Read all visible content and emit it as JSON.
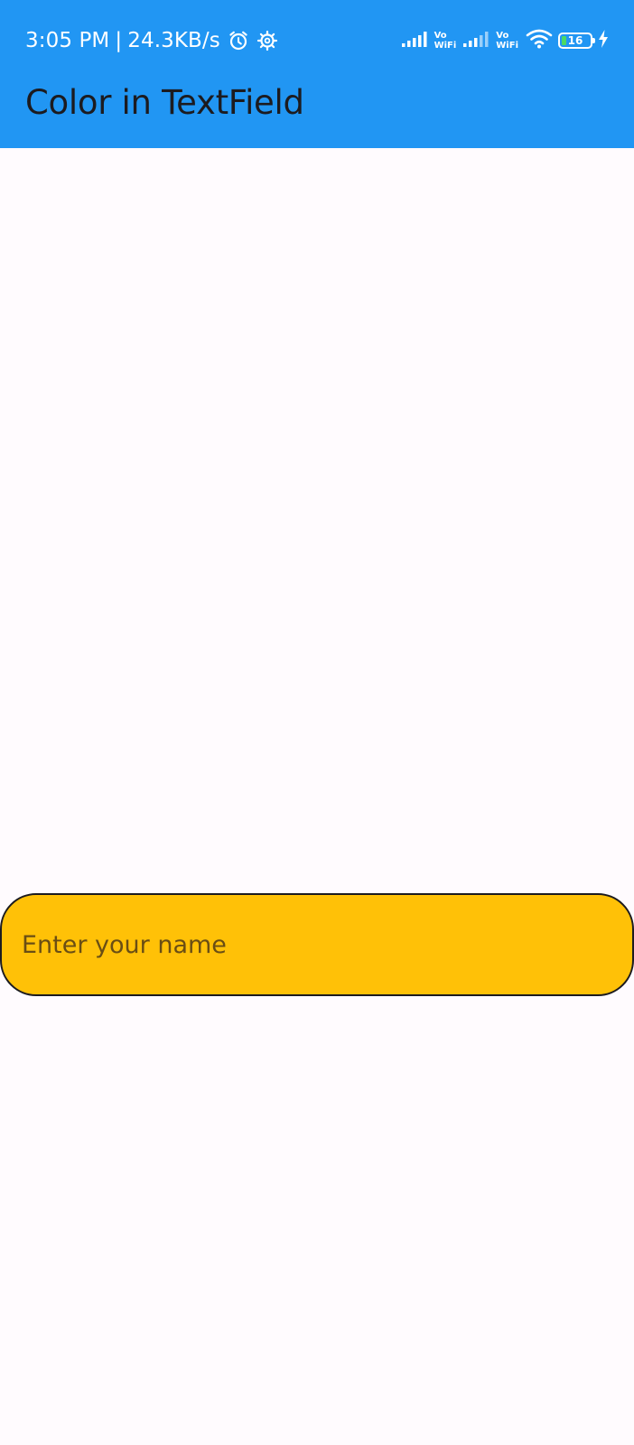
{
  "status_bar": {
    "time": "3:05 PM",
    "separator": "|",
    "network_speed": "24.3KB/s",
    "left_icons": [
      "alarm-icon",
      "settings-gear-icon"
    ],
    "right_icons": [
      "signal-icon",
      "vowifi-icon",
      "signal-icon",
      "vowifi-icon",
      "wifi-icon",
      "battery-icon",
      "charging-bolt-icon"
    ],
    "vowifi_top": "Vo",
    "vowifi_bottom": "WiFi",
    "battery_level": "16",
    "color": "#2196f3"
  },
  "app_bar": {
    "title": "Color in TextField",
    "color": "#2196f3"
  },
  "text_field": {
    "placeholder": "Enter your name",
    "value": "",
    "fill_color": "#ffc107",
    "border_color": "#1c1b1f"
  },
  "background_color": "#fffbfe"
}
